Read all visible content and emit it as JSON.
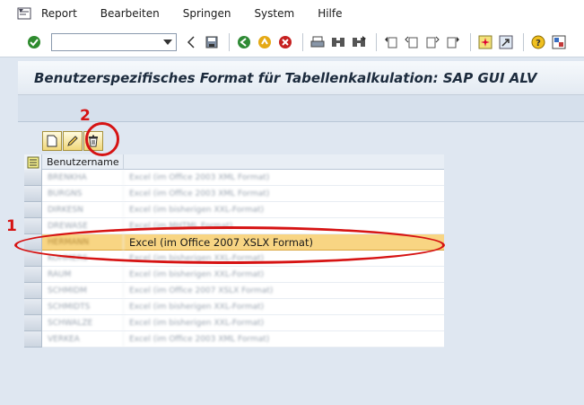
{
  "menu": {
    "items": [
      "Report",
      "Bearbeiten",
      "Springen",
      "System",
      "Hilfe"
    ]
  },
  "toolbar": {
    "command_value": "",
    "icons": [
      "check-icon",
      "back-icon",
      "save-icon",
      "back-green-icon",
      "exit-icon",
      "cancel-icon",
      "print-icon",
      "find-icon",
      "find-next-icon",
      "first-page-icon",
      "prev-page-icon",
      "next-page-icon",
      "last-page-icon",
      "new-session-icon",
      "shortcut-icon",
      "help-icon",
      "layout-icon"
    ]
  },
  "title": "Benutzerspezifisches Format für Tabellenkalkulation: SAP GUI ALV",
  "alv_toolbar": {
    "icons": [
      "create-icon",
      "edit-icon",
      "delete-icon"
    ]
  },
  "grid": {
    "header_user": "Benutzername",
    "rows": [
      {
        "user": "BRENKHA",
        "format": "Excel (im Office 2003 XML Format)"
      },
      {
        "user": "BURGNS",
        "format": "Excel (im Office 2003 XML Format)"
      },
      {
        "user": "DIRKESN",
        "format": "Excel (im bisherigen XXL-Format)"
      },
      {
        "user": "DREWASE",
        "format": "Excel (im MHTML Format)"
      },
      {
        "user": "HERMANN",
        "format": "Excel (im Office 2007 XSLX Format)"
      },
      {
        "user": "KOHMERS",
        "format": "Excel (im bisherigen XXL-Format)"
      },
      {
        "user": "RAUM",
        "format": "Excel (im bisherigen XXL-Format)"
      },
      {
        "user": "SCHMIDM",
        "format": "Excel (im Office 2007 XSLX Format)"
      },
      {
        "user": "SCHMIDTS",
        "format": "Excel (im bisherigen XXL-Format)"
      },
      {
        "user": "SCHWALZE",
        "format": "Excel (im bisherigen XXL-Format)"
      },
      {
        "user": "VERKEA",
        "format": "Excel (im Office 2003 XML Format)"
      }
    ],
    "selected_index": 4
  },
  "annotations": {
    "one": "1",
    "two": "2"
  },
  "colors": {
    "selected_row": "#f8d583",
    "annotation": "#d61313"
  }
}
